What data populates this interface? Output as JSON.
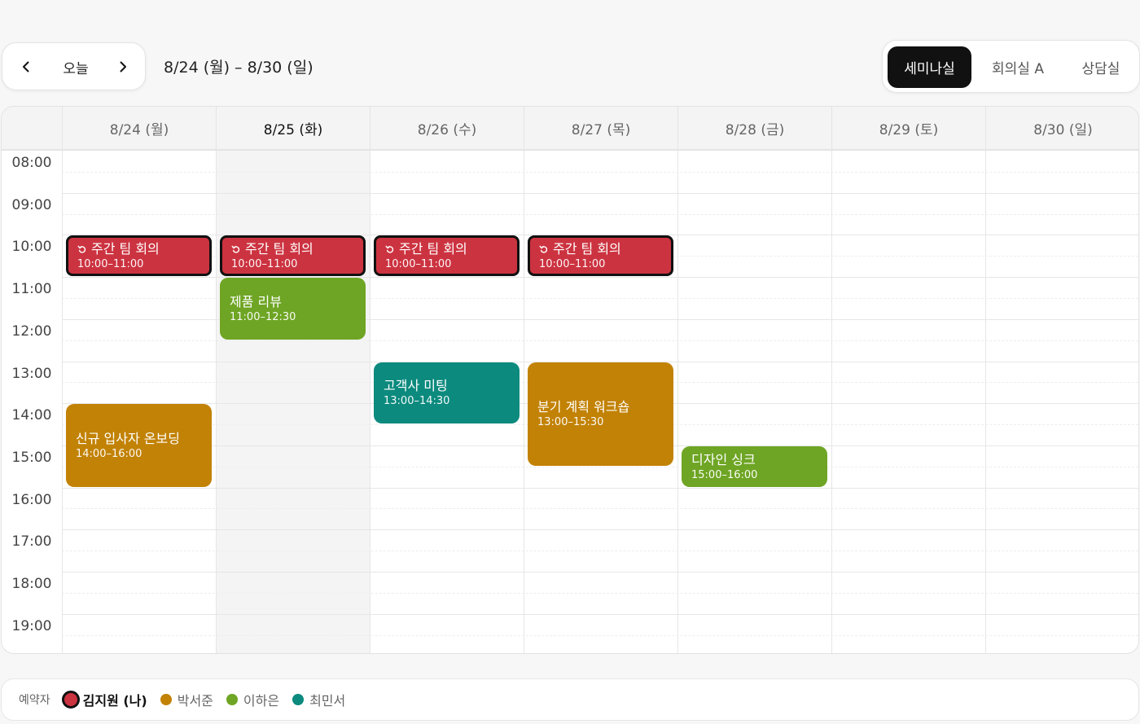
{
  "toolbar": {
    "today_label": "오늘",
    "range_label": "8/24 (월) – 8/30 (일)"
  },
  "rooms": [
    {
      "label": "세미나실",
      "active": true
    },
    {
      "label": "회의실 A",
      "active": false
    },
    {
      "label": "상담실",
      "active": false
    }
  ],
  "days": [
    {
      "label": "8/24 (월)",
      "today": false
    },
    {
      "label": "8/25 (화)",
      "today": true
    },
    {
      "label": "8/26 (수)",
      "today": false
    },
    {
      "label": "8/27 (목)",
      "today": false
    },
    {
      "label": "8/28 (금)",
      "today": false
    },
    {
      "label": "8/29 (토)",
      "today": false
    },
    {
      "label": "8/30 (일)",
      "today": false
    }
  ],
  "hours": [
    "08:00",
    "09:00",
    "10:00",
    "11:00",
    "12:00",
    "13:00",
    "14:00",
    "15:00",
    "16:00",
    "17:00",
    "18:00",
    "19:00"
  ],
  "events": [
    {
      "day": 0,
      "start": "10:00",
      "end": "11:00",
      "title": "주간 팀 회의",
      "time": "10:00–11:00",
      "color": "#cc3340",
      "mine": true,
      "recurring": true
    },
    {
      "day": 1,
      "start": "10:00",
      "end": "11:00",
      "title": "주간 팀 회의",
      "time": "10:00–11:00",
      "color": "#cc3340",
      "mine": true,
      "recurring": true
    },
    {
      "day": 2,
      "start": "10:00",
      "end": "11:00",
      "title": "주간 팀 회의",
      "time": "10:00–11:00",
      "color": "#cc3340",
      "mine": true,
      "recurring": true
    },
    {
      "day": 3,
      "start": "10:00",
      "end": "11:00",
      "title": "주간 팀 회의",
      "time": "10:00–11:00",
      "color": "#cc3340",
      "mine": true,
      "recurring": true
    },
    {
      "day": 1,
      "start": "11:00",
      "end": "12:30",
      "title": "제품 리뷰",
      "time": "11:00–12:30",
      "color": "#6ea524",
      "mine": false,
      "recurring": false
    },
    {
      "day": 2,
      "start": "13:00",
      "end": "14:30",
      "title": "고객사 미팅",
      "time": "13:00–14:30",
      "color": "#0c8a7e",
      "mine": false,
      "recurring": false
    },
    {
      "day": 3,
      "start": "13:00",
      "end": "15:30",
      "title": "분기 계획 워크숍",
      "time": "13:00–15:30",
      "color": "#c28205",
      "mine": false,
      "recurring": false
    },
    {
      "day": 0,
      "start": "14:00",
      "end": "16:00",
      "title": "신규 입사자 온보딩",
      "time": "14:00–16:00",
      "color": "#c28205",
      "mine": false,
      "recurring": false
    },
    {
      "day": 4,
      "start": "15:00",
      "end": "16:00",
      "title": "디자인 싱크",
      "time": "15:00–16:00",
      "color": "#6ea524",
      "mine": false,
      "recurring": false
    }
  ],
  "legend": {
    "label": "예약자",
    "items": [
      {
        "name": "김지원 (나)",
        "color": "#cc3340",
        "me": true
      },
      {
        "name": "박서준",
        "color": "#c28205",
        "me": false
      },
      {
        "name": "이하은",
        "color": "#6ea524",
        "me": false
      },
      {
        "name": "최민서",
        "color": "#0c8a7e",
        "me": false
      }
    ]
  },
  "icons": {
    "prev": "chevron-left-icon",
    "next": "chevron-right-icon",
    "recurring": "repeat-icon"
  }
}
